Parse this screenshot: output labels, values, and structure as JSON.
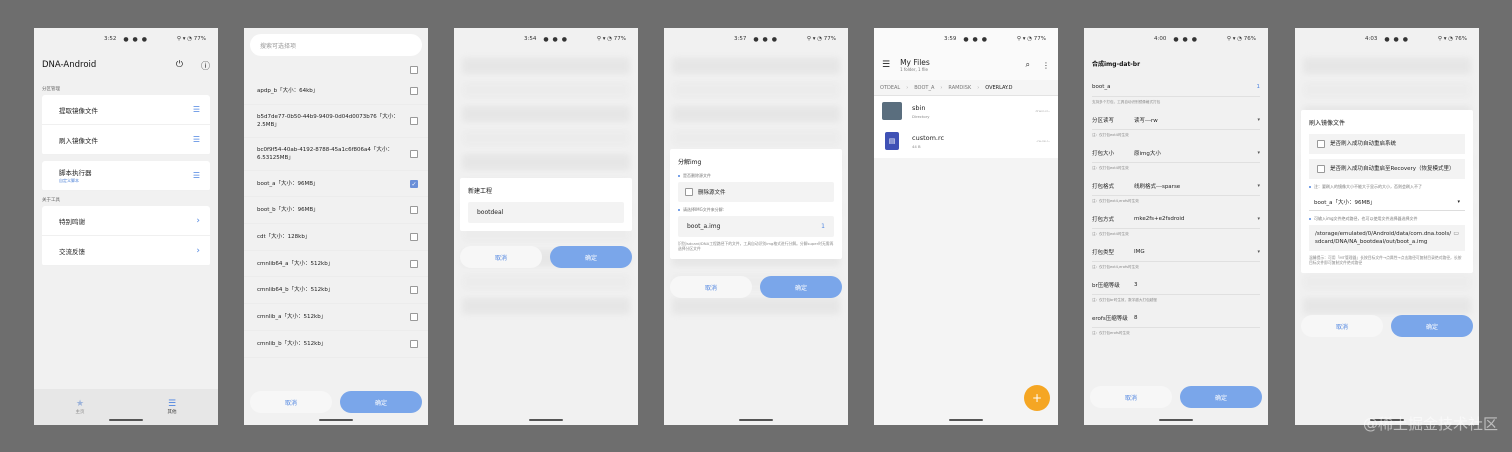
{
  "screens": {
    "s1": {
      "status": {
        "time": "3:52",
        "battery": "77%"
      },
      "app_title": "DNA-Android",
      "section1": "分区管理",
      "items1": [
        {
          "label": "提取镜像文件"
        },
        {
          "label": "刷入镜像文件"
        }
      ],
      "script": {
        "label": "脚本执行器",
        "sub": "自定义脚本"
      },
      "section2": "关于工具",
      "items2": [
        {
          "label": "特别鸣谢"
        },
        {
          "label": "交流反馈"
        }
      ],
      "nav": {
        "home": "主页",
        "other": "其他"
      }
    },
    "s2": {
      "search_placeholder": "搜索可选择项",
      "files": [
        {
          "label": "apdp_b「大小：64kb」",
          "checked": false
        },
        {
          "label": "b5d7de77-0b50-44b9-9409-0d04d0073b76「大小：2.5MB」",
          "checked": false
        },
        {
          "label": "bc0f9f54-40ab-4192-8788-45a1c6f806a4「大小：6.53125MB」",
          "checked": false
        },
        {
          "label": "boot_a「大小：96MB」",
          "checked": true
        },
        {
          "label": "boot_b「大小：96MB」",
          "checked": false
        },
        {
          "label": "cdt「大小：128kb」",
          "checked": false
        },
        {
          "label": "cmnlib64_a「大小：512kb」",
          "checked": false
        },
        {
          "label": "cmnlib64_b「大小：512kb」",
          "checked": false
        },
        {
          "label": "cmnlib_a「大小：512kb」",
          "checked": false
        },
        {
          "label": "cmnlib_b「大小：512kb」",
          "checked": false
        }
      ],
      "cancel": "取消",
      "ok": "确定"
    },
    "s3": {
      "status": {
        "time": "3:54",
        "battery": "77%"
      },
      "dialog_title": "新建工程",
      "input_value": "bootdeal",
      "cancel": "取消",
      "ok": "确定"
    },
    "s4": {
      "status": {
        "time": "3:57",
        "battery": "77%"
      },
      "dialog_title": "分解img",
      "hint1": "是否删除源文件",
      "checkbox": "删除源文件",
      "hint2": "请选择IMG文件来分解:",
      "input_value": "boot_a.img",
      "input_num": "1",
      "note": "识别/sdcard/DNA工程路径下的文件，工具自动识别img格式进行分解。分解super时无需再选择分区文件",
      "cancel": "取消",
      "ok": "确定"
    },
    "s5": {
      "status": {
        "time": "3:59",
        "battery": "77%"
      },
      "title": "My Files",
      "subtitle": "1 folder, 1 file",
      "crumbs": [
        "OTDEAL",
        "BOOT_A",
        "RAMDISK",
        "OVERLAY.D"
      ],
      "entries": [
        {
          "name": "sbin",
          "sub": "Directory",
          "meta": "drwxr-xr--"
        },
        {
          "name": "custom.rc",
          "sub": "44 B",
          "meta": "-rw-rw-r--"
        }
      ]
    },
    "s6": {
      "status": {
        "time": "4:00",
        "battery": "76%"
      },
      "header": "合成img-dat-br",
      "first": {
        "value": "boot_a",
        "num": "1",
        "note": "支持多个打包，工具自动识别镜像格式打包"
      },
      "rows": [
        {
          "k": "分区读写",
          "v": "读写---rw",
          "note": "注：仅打包ext4时生效"
        },
        {
          "k": "打包大小",
          "v": "原img大小",
          "note": "注：仅打包ext4时生效"
        },
        {
          "k": "打包格式",
          "v": "线刷格式---sparse",
          "note": "注：仅打包ext4,erofs时生效"
        },
        {
          "k": "打包方式",
          "v": "mke2fs+e2fsdroid",
          "note": "注：仅打包ext4时生效"
        },
        {
          "k": "打包类型",
          "v": "IMG",
          "note": "注：仅打包ext4,erofs时生效"
        },
        {
          "k": "br压缩等级",
          "v": "3",
          "note": "注：仅打包br时生效，数字越大打包越慢"
        },
        {
          "k": "erofs压缩等级",
          "v": "8",
          "note": "注：仅打包erofs时生效"
        }
      ],
      "cancel": "取消",
      "ok": "确定"
    },
    "s7": {
      "status": {
        "time": "4:03",
        "battery": "76%"
      },
      "dialog_title": "刷入镜像文件",
      "opt1": "是否刷入成功自动重启系统",
      "opt2": "是否刷入成功自动重启至Recovery（恢复模式里）",
      "hint1": "注：要刷入的镜像大小不能大于显示的大小，否则会刷入不了",
      "select": "boot_a「大小：96MB」",
      "hint2": "可输入img文件绝对路径，也可以使用文件选择器选择文件",
      "path": "/storage/emulated/0/Android/data/com.dna.tools/sdcard/DNA/NA_bootdeal/out/boot_a.img",
      "note": "温馨提示：可用「MT管理器」长按目标文件→点属性→点击路径可复制目录绝对路径，长按目标文件即可复制文件绝对路径",
      "cancel": "取消",
      "ok": "确定"
    }
  },
  "watermark": "@稀土掘金技术社区"
}
